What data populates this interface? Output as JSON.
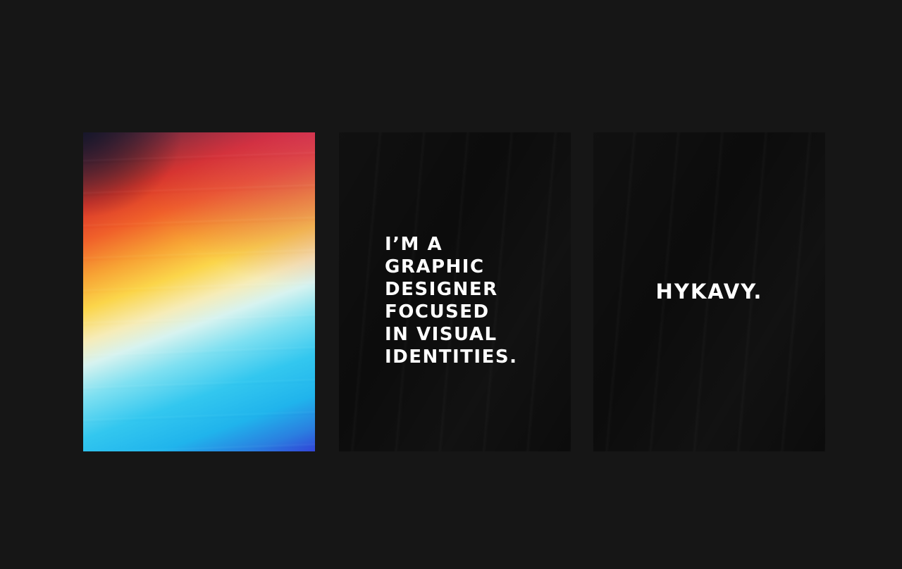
{
  "background_color": "#161616",
  "posters": {
    "gradient": {
      "colors": [
        "#d8362a",
        "#f7a234",
        "#fbd54a",
        "#f6ecb8",
        "#33c7ef",
        "#3345d8"
      ]
    },
    "statement": {
      "lines": [
        "I’M A",
        "GRAPHIC",
        "DESIGNER",
        "FOCUSED",
        "IN VISUAL",
        "IDENTITIES."
      ],
      "text_color": "#ffffff",
      "poster_color": "#0c0c0c"
    },
    "logo": {
      "wordmark": "HYKAVY.",
      "text_color": "#ffffff",
      "poster_color": "#0c0c0c"
    }
  }
}
